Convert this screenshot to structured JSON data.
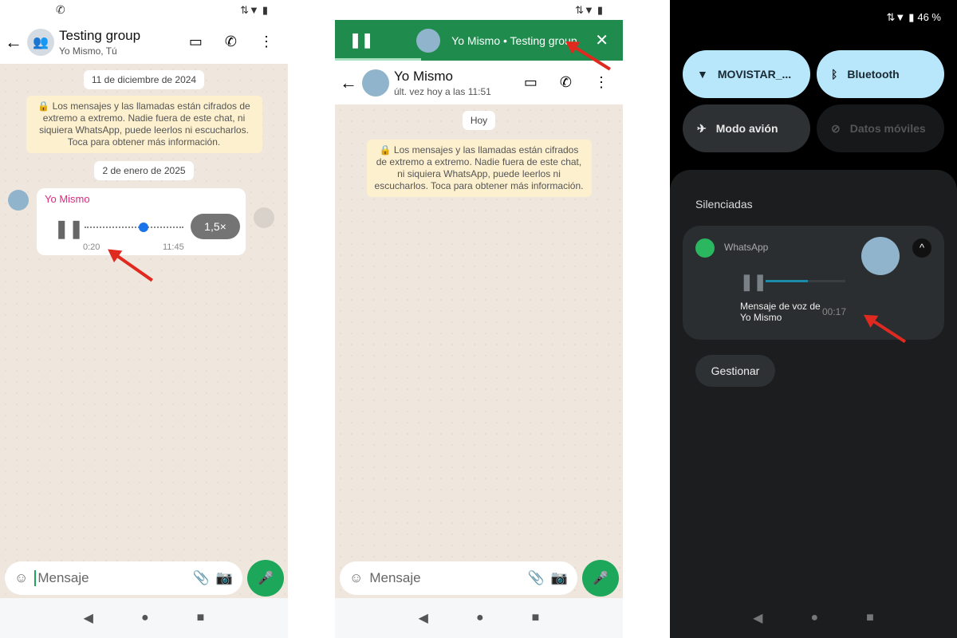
{
  "panel1": {
    "status_icon": "whatsapp-icon",
    "chat_title": "Testing group",
    "chat_subtitle": "Yo Mismo, Tú",
    "date1": "11 de diciembre de 2024",
    "e2e_notice": "🔒 Los mensajes y las llamadas están cifrados de extremo a extremo. Nadie fuera de este chat, ni siquiera WhatsApp, puede leerlos ni escucharlos. Toca para obtener más información.",
    "date2": "2 de enero de 2025",
    "voice_message": {
      "sender": "Yo Mismo",
      "elapsed": "0:20",
      "time": "11:45",
      "speed": "1,5×",
      "progress": 0.55
    },
    "input_placeholder": "Mensaje"
  },
  "panel2": {
    "mini_player_label": "Yo Mismo • Testing group",
    "mini_player_progress": 0.3,
    "chat_title": "Yo Mismo",
    "chat_subtitle": "últ. vez hoy a las 11:51",
    "date": "Hoy",
    "e2e_notice": "🔒 Los mensajes y las llamadas están cifrados de extremo a extremo. Nadie fuera de este chat, ni siquiera WhatsApp, puede leerlos ni escucharlos. Toca para obtener más información.",
    "input_placeholder": "Mensaje"
  },
  "panel3": {
    "battery": "46 %",
    "tiles": [
      {
        "label": "MOVISTAR_...",
        "icon": "wifi-icon",
        "active": true
      },
      {
        "label": "Bluetooth",
        "icon": "bluetooth-icon",
        "active": true
      },
      {
        "label": "Modo avión",
        "icon": "airplane-icon",
        "active": false
      },
      {
        "label": "Datos móviles",
        "icon": "mobile-data-off-icon",
        "active": false
      }
    ],
    "section_title": "Silenciadas",
    "notification": {
      "app": "WhatsApp",
      "message": "Mensaje de voz de Yo Mismo",
      "duration": "00:17",
      "progress": 0.5
    },
    "manage_label": "Gestionar"
  },
  "colors": {
    "whatsapp_green": "#1da75a",
    "mini_player_green": "#1f8c4e",
    "sender_pink": "#e0287e",
    "tile_active": "#b8e6fb"
  }
}
